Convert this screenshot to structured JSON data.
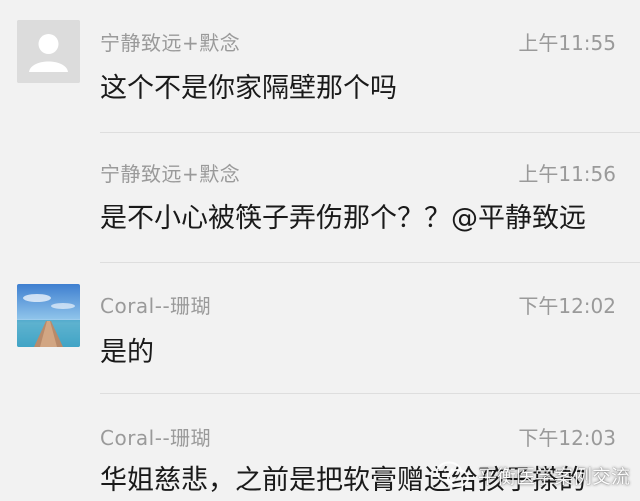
{
  "messages": [
    {
      "sender": "宁静致远+默念",
      "time": "上午11:55",
      "text": "这个不是你家隔壁那个吗",
      "avatar": "default-user-icon"
    },
    {
      "sender": "宁静致远+默念",
      "time": "上午11:56",
      "text": "是不小心被筷子弄伤那个？？@平静致远",
      "avatar": "none"
    },
    {
      "sender": "Coral--珊瑚",
      "time": "下午12:02",
      "text": "是的",
      "avatar": "seaside-pier-photo"
    },
    {
      "sender": "Coral--珊瑚",
      "time": "下午12:03",
      "text": "华姐慈悲，之前是把软膏赠送给孩子搽的",
      "avatar": "none"
    }
  ],
  "watermark": {
    "text": "平衡医学案例交流",
    "icon": "wechat-icon"
  },
  "colors": {
    "background": "#f2f2f2",
    "meta_text": "#9a9a9a",
    "body_text": "#1a1a1a",
    "divider": "#dedede"
  }
}
